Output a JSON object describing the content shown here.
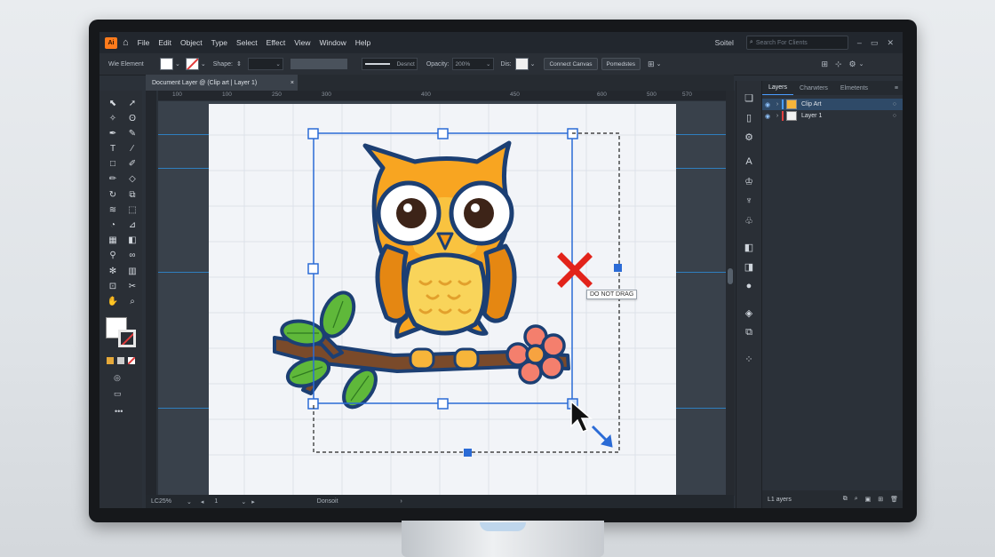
{
  "menubar": {
    "logo": "Ai",
    "items": [
      "File",
      "Edit",
      "Object",
      "Type",
      "Select",
      "Effect",
      "View",
      "Window",
      "Help"
    ],
    "workspace": "Soitel",
    "search_placeholder": "Search For Clients",
    "window_controls": [
      "–",
      "▭",
      "✕"
    ]
  },
  "controlbar": {
    "label": "Wie Element",
    "shape_label": "Shape:",
    "stroke_style": "Desnct",
    "opacity_label": "Opacity:",
    "opacity_value": "200%",
    "dist_label": "Dis:",
    "convert_button": "Connect Canvas",
    "properties_button": "Pomedstes"
  },
  "document_tab": {
    "title": "Document Layer @ (Clip art | Layer 1)",
    "close": "×"
  },
  "ruler": {
    "labels": [
      "100",
      "100",
      "250",
      "300",
      "400",
      "450",
      "600",
      "500",
      "570"
    ]
  },
  "canvas": {
    "tooltip": "DO NOT DRAG",
    "accent_blue": "#2b6bd6",
    "warning_red": "#e2231a"
  },
  "statusbar": {
    "zoom": "LC25%",
    "page": "1",
    "center_text": "Donsoit"
  },
  "layers_panel": {
    "tabs": [
      "Layers",
      "Charwters",
      "Elmetents"
    ],
    "layers": [
      {
        "name": "Clip Art",
        "selected": true,
        "color": "#4a9cff"
      },
      {
        "name": "Layer 1",
        "selected": false,
        "color": "#e04040"
      }
    ],
    "footer": "L1 ayers"
  },
  "tools": [
    "arrow-icon",
    "direct-select-icon",
    "magic-wand-icon",
    "lasso-icon",
    "pen-icon",
    "curvature-icon",
    "type-icon",
    "line-icon",
    "rectangle-icon",
    "paintbrush-icon",
    "pencil-icon",
    "eraser-icon",
    "rotate-icon",
    "scale-icon",
    "width-icon",
    "free-transform-icon",
    "shape-builder-icon",
    "perspective-icon",
    "mesh-icon",
    "gradient-icon",
    "eyedropper-icon",
    "blend-icon",
    "symbol-sprayer-icon",
    "graph-icon",
    "artboard-icon",
    "slice-icon",
    "hand-icon",
    "zoom-icon"
  ]
}
